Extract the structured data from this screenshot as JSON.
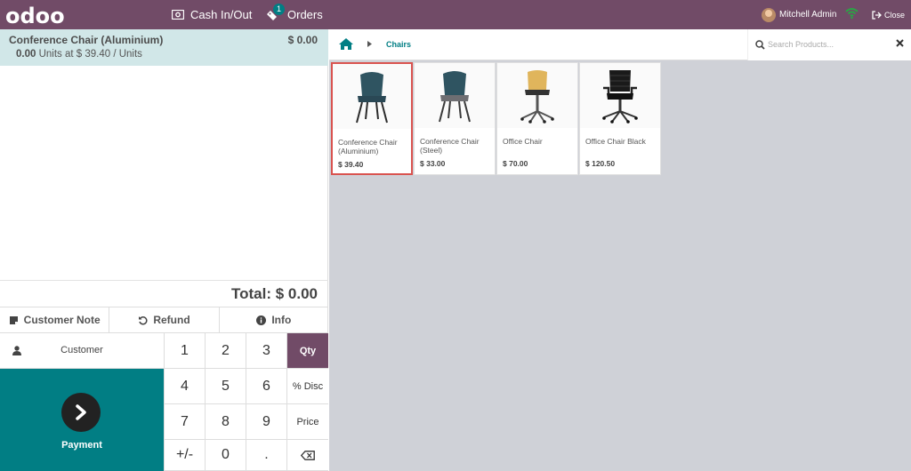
{
  "topbar": {
    "logo": "odoo",
    "cash_label": "Cash In/Out",
    "orders_label": "Orders",
    "orders_count": "1",
    "user_name": "Mitchell Admin",
    "close_label": "Close"
  },
  "order": {
    "line": {
      "name": "Conference Chair (Aluminium)",
      "price": "$ 0.00",
      "qty": "0.00",
      "detail": "Units at $ 39.40 / Units"
    },
    "total": "Total: $ 0.00"
  },
  "tabs": {
    "customer_note": "Customer Note",
    "refund": "Refund",
    "info": "Info"
  },
  "customer_label": "Customer",
  "payment_label": "Payment",
  "numpad": {
    "keys": [
      "1",
      "2",
      "3",
      "Qty",
      "4",
      "5",
      "6",
      "% Disc",
      "7",
      "8",
      "9",
      "Price",
      "+/-",
      "0",
      ".",
      ""
    ]
  },
  "breadcrumb": {
    "category": "Chairs"
  },
  "search": {
    "placeholder": "Search Products..."
  },
  "products": [
    {
      "name": "Conference Chair (Aluminium)",
      "price": "$ 39.40"
    },
    {
      "name": "Conference Chair (Steel)",
      "price": "$ 33.00"
    },
    {
      "name": "Office Chair",
      "price": "$ 70.00"
    },
    {
      "name": "Office Chair Black",
      "price": "$ 120.50"
    }
  ],
  "colors": {
    "brand": "#714b67",
    "accent": "#017e84",
    "selected_line": "#d1e7e8"
  }
}
